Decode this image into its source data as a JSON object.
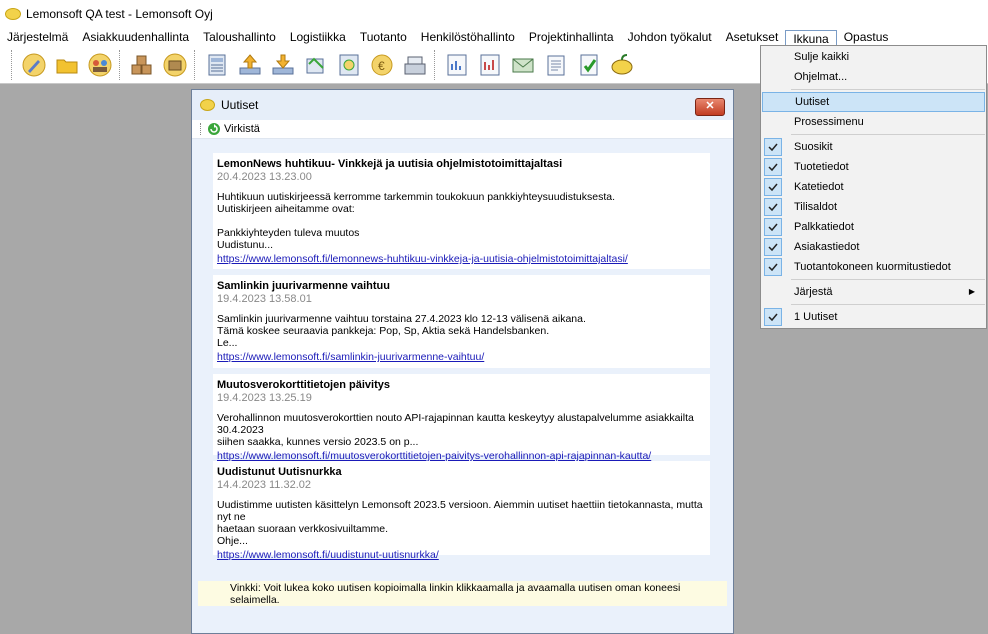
{
  "app": {
    "title": "Lemonsoft QA test - Lemonsoft Oyj"
  },
  "menubar": [
    "Järjestelmä",
    "Asiakkuudenhallinta",
    "Taloushallinto",
    "Logistiikka",
    "Tuotanto",
    "Henkilöstöhallinto",
    "Projektinhallinta",
    "Johdon työkalut",
    "Asetukset",
    "Ikkuna",
    "Opastus"
  ],
  "menubar_open": "Ikkuna",
  "toolbar_icons": [
    "pen-icon",
    "folder-icon",
    "people-icon",
    "boxes-icon",
    "coins-icon",
    "calculator-icon",
    "upload-icon",
    "download-icon",
    "truck-icon",
    "document-money-icon",
    "money-icon",
    "cash-register-icon",
    "report-icon",
    "report-chart-icon",
    "envelope-icon",
    "clipboard-icon",
    "checklist-icon",
    "lemon-icon"
  ],
  "news_window": {
    "title": "Uutiset",
    "close_label": "✕",
    "refresh_label": "Virkistä",
    "items": [
      {
        "title": "LemonNews huhtikuu- Vinkkejä ja uutisia ohjelmistotoimittajaltasi",
        "date": "20.4.2023 13.23.00",
        "body": "Huhtikuun uutiskirjeessä kerromme tarkemmin toukokuun pankkiyhteysuudistuksesta.\nUutiskirjeen aiheitamme ovat:\n\nPankkiyhteyden tuleva muutos\nUudistunu...",
        "link": "https://www.lemonsoft.fi/lemonnews-huhtikuu-vinkkeja-ja-uutisia-ohjelmistotoimittajaltasi/"
      },
      {
        "title": "Samlinkin juurivarmenne vaihtuu",
        "date": "19.4.2023 13.58.01",
        "body": "Samlinkin juurivarmenne vaihtuu torstaina 27.4.2023  klo 12-13 välisenä aikana.\nTämä koskee seuraavia pankkeja: Pop, Sp, Aktia sekä Handelsbanken.\nLe...",
        "link": "https://www.lemonsoft.fi/samlinkin-juurivarmenne-vaihtuu/"
      },
      {
        "title": "Muutosverokorttitietojen päivitys",
        "date": "19.4.2023 13.25.19",
        "body": "Verohallinnon muutosverokorttien nouto API-rajapinnan kautta keskeytyy alustapalvelumme asiakkailta 30.4.2023\nsiihen saakka, kunnes versio 2023.5 on p...",
        "link": "https://www.lemonsoft.fi/muutosverokorttitietojen-paivitys-verohallinnon-api-rajapinnan-kautta/"
      },
      {
        "title": "Uudistunut Uutisnurkka",
        "date": "14.4.2023 11.32.02",
        "body": "Uudistimme uutisten käsittelyn Lemonsoft 2023.5 versioon. Aiemmin uutiset haettiin tietokannasta, mutta nyt ne\nhaetaan suoraan verkkosivuiltamme.\nOhje...",
        "link": "https://www.lemonsoft.fi/uudistunut-uutisnurkka/"
      }
    ],
    "tip": "Vinkki: Voit lukea koko uutisen kopioimalla linkin klikkaamalla ja avaamalla uutisen oman koneesi selaimella."
  },
  "ikkuna_menu": {
    "items": [
      {
        "label": "Sulje kaikki",
        "checked": false
      },
      {
        "label": "Ohjelmat...",
        "checked": false
      },
      {
        "label": "Uutiset",
        "checked": false,
        "highlighted": true
      },
      {
        "label": "Prosessimenu",
        "checked": false
      },
      {
        "label": "Suosikit",
        "checked": true
      },
      {
        "label": "Tuotetiedot",
        "checked": true
      },
      {
        "label": "Katetiedot",
        "checked": true
      },
      {
        "label": "Tilisaldot",
        "checked": true
      },
      {
        "label": "Palkkatiedot",
        "checked": true
      },
      {
        "label": "Asiakastiedot",
        "checked": true
      },
      {
        "label": "Tuotantokoneen kuormitustiedot",
        "checked": true
      },
      {
        "label": "Järjestä",
        "checked": false,
        "submenu": true
      },
      {
        "label": "1 Uutiset",
        "checked": true
      }
    ]
  }
}
